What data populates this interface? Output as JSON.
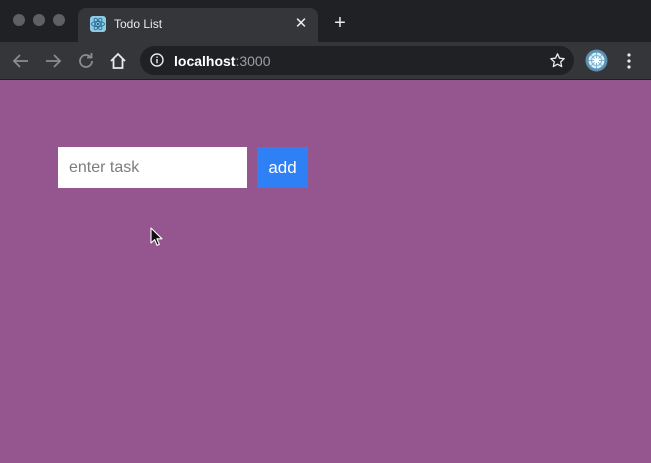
{
  "browser": {
    "tab": {
      "title": "Todo List",
      "favicon": "react-logo-icon",
      "close_glyph": "✕"
    },
    "new_tab_glyph": "+",
    "address": {
      "host": "localhost",
      "port": ":3000"
    },
    "colors": {
      "tab_strip": "#202124",
      "toolbar": "#35363a"
    }
  },
  "page": {
    "background": "#95568f",
    "form": {
      "input_placeholder": "enter task",
      "input_value": "",
      "add_label": "add",
      "add_color": "#2f80f5"
    }
  }
}
